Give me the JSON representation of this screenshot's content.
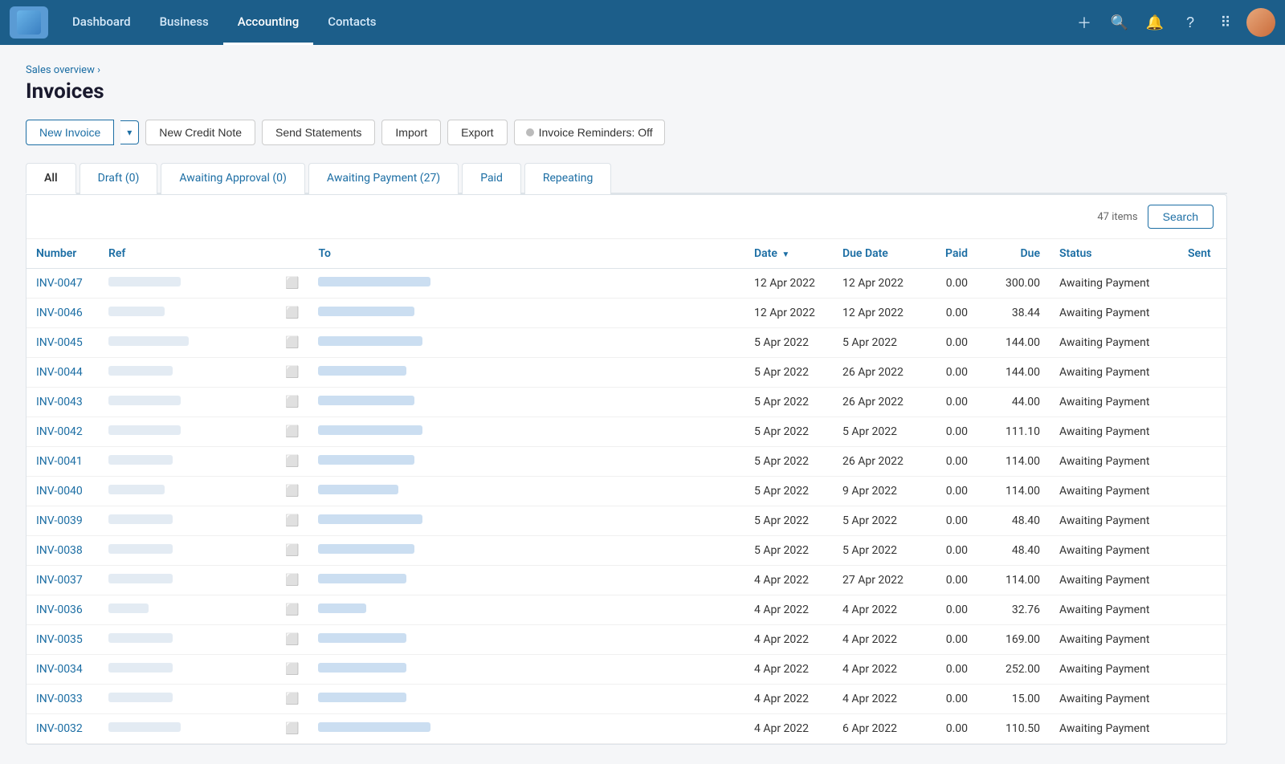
{
  "topnav": {
    "links": [
      {
        "label": "Dashboard",
        "active": false
      },
      {
        "label": "Business",
        "active": false
      },
      {
        "label": "Accounting",
        "active": true
      },
      {
        "label": "Contacts",
        "active": false
      }
    ],
    "icons": [
      "plus",
      "search",
      "bell",
      "question",
      "grid"
    ]
  },
  "breadcrumb": "Sales overview ›",
  "page_title": "Invoices",
  "toolbar": {
    "new_invoice": "New Invoice",
    "new_credit_note": "New Credit Note",
    "send_statements": "Send Statements",
    "import": "Import",
    "export": "Export",
    "invoice_reminders": "Invoice Reminders: Off"
  },
  "tabs": [
    {
      "label": "All",
      "active": true
    },
    {
      "label": "Draft (0)",
      "active": false
    },
    {
      "label": "Awaiting Approval (0)",
      "active": false
    },
    {
      "label": "Awaiting Payment (27)",
      "active": false
    },
    {
      "label": "Paid",
      "active": false
    },
    {
      "label": "Repeating",
      "active": false
    }
  ],
  "table": {
    "items_count": "47 items",
    "search_button": "Search",
    "columns": [
      "Number",
      "Ref",
      "",
      "To",
      "Date",
      "Due Date",
      "Paid",
      "Due",
      "Status",
      "Sent"
    ],
    "rows": [
      {
        "number": "INV-0047",
        "date": "12 Apr 2022",
        "due_date": "12 Apr 2022",
        "paid": "0.00",
        "due": "300.00",
        "status": "Awaiting Payment"
      },
      {
        "number": "INV-0046",
        "date": "12 Apr 2022",
        "due_date": "12 Apr 2022",
        "paid": "0.00",
        "due": "38.44",
        "status": "Awaiting Payment"
      },
      {
        "number": "INV-0045",
        "date": "5 Apr 2022",
        "due_date": "5 Apr 2022",
        "paid": "0.00",
        "due": "144.00",
        "status": "Awaiting Payment"
      },
      {
        "number": "INV-0044",
        "date": "5 Apr 2022",
        "due_date": "26 Apr 2022",
        "paid": "0.00",
        "due": "144.00",
        "status": "Awaiting Payment"
      },
      {
        "number": "INV-0043",
        "date": "5 Apr 2022",
        "due_date": "26 Apr 2022",
        "paid": "0.00",
        "due": "44.00",
        "status": "Awaiting Payment"
      },
      {
        "number": "INV-0042",
        "date": "5 Apr 2022",
        "due_date": "5 Apr 2022",
        "paid": "0.00",
        "due": "111.10",
        "status": "Awaiting Payment"
      },
      {
        "number": "INV-0041",
        "date": "5 Apr 2022",
        "due_date": "26 Apr 2022",
        "paid": "0.00",
        "due": "114.00",
        "status": "Awaiting Payment"
      },
      {
        "number": "INV-0040",
        "date": "5 Apr 2022",
        "due_date": "9 Apr 2022",
        "paid": "0.00",
        "due": "114.00",
        "status": "Awaiting Payment"
      },
      {
        "number": "INV-0039",
        "date": "5 Apr 2022",
        "due_date": "5 Apr 2022",
        "paid": "0.00",
        "due": "48.40",
        "status": "Awaiting Payment"
      },
      {
        "number": "INV-0038",
        "date": "5 Apr 2022",
        "due_date": "5 Apr 2022",
        "paid": "0.00",
        "due": "48.40",
        "status": "Awaiting Payment"
      },
      {
        "number": "INV-0037",
        "date": "4 Apr 2022",
        "due_date": "27 Apr 2022",
        "paid": "0.00",
        "due": "114.00",
        "status": "Awaiting Payment"
      },
      {
        "number": "INV-0036",
        "date": "4 Apr 2022",
        "due_date": "4 Apr 2022",
        "paid": "0.00",
        "due": "32.76",
        "status": "Awaiting Payment"
      },
      {
        "number": "INV-0035",
        "date": "4 Apr 2022",
        "due_date": "4 Apr 2022",
        "paid": "0.00",
        "due": "169.00",
        "status": "Awaiting Payment"
      },
      {
        "number": "INV-0034",
        "date": "4 Apr 2022",
        "due_date": "4 Apr 2022",
        "paid": "0.00",
        "due": "252.00",
        "status": "Awaiting Payment"
      },
      {
        "number": "INV-0033",
        "date": "4 Apr 2022",
        "due_date": "4 Apr 2022",
        "paid": "0.00",
        "due": "15.00",
        "status": "Awaiting Payment"
      },
      {
        "number": "INV-0032",
        "date": "4 Apr 2022",
        "due_date": "6 Apr 2022",
        "paid": "0.00",
        "due": "110.50",
        "status": "Awaiting Payment"
      }
    ],
    "ref_widths": [
      90,
      70,
      100,
      80,
      90,
      90,
      80,
      70,
      80,
      80,
      80,
      50,
      80,
      0,
      80,
      90
    ],
    "to_widths": [
      140,
      120,
      130,
      110,
      120,
      130,
      120,
      100,
      130,
      120,
      110,
      60,
      110,
      0,
      110,
      140
    ]
  }
}
